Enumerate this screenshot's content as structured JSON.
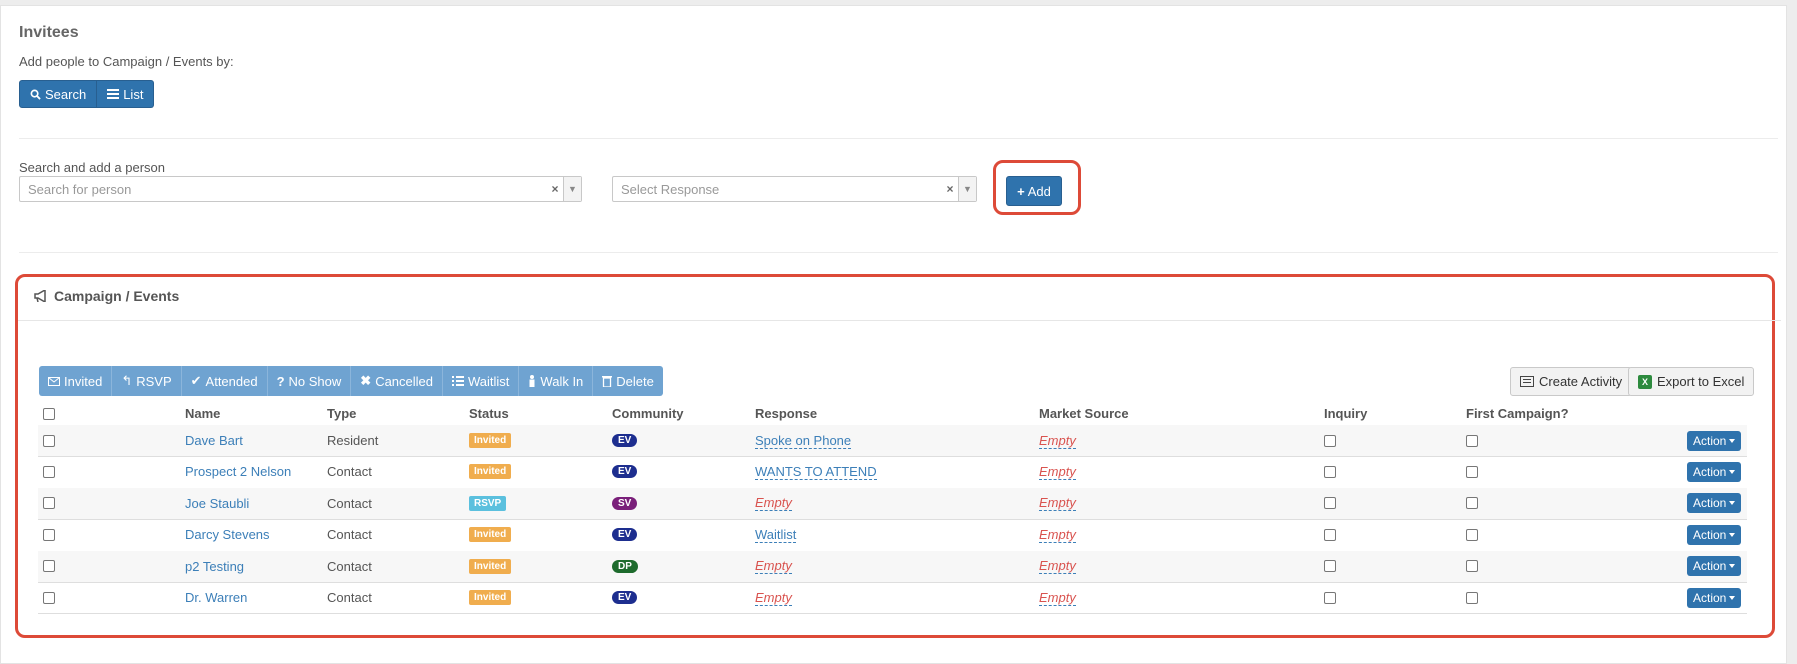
{
  "invitees": {
    "title": "Invitees",
    "subtitle": "Add people to Campaign / Events by:",
    "mode_buttons": [
      {
        "label": "Search",
        "icon": "search-icon"
      },
      {
        "label": "List",
        "icon": "list-icon"
      }
    ]
  },
  "search": {
    "label": "Search and add a person",
    "person_placeholder": "Search for person",
    "response_placeholder": "Select Response",
    "add_label": "Add"
  },
  "campaign": {
    "title": "Campaign / Events",
    "title_icon": "bullhorn-icon",
    "toolbar": [
      {
        "label": "Invited",
        "icon": "envelope-icon"
      },
      {
        "label": "RSVP",
        "icon": "reply-icon"
      },
      {
        "label": "Attended",
        "icon": "check-icon"
      },
      {
        "label": "No Show",
        "icon": "question-icon"
      },
      {
        "label": "Cancelled",
        "icon": "close-icon"
      },
      {
        "label": "Waitlist",
        "icon": "list-ol-icon"
      },
      {
        "label": "Walk In",
        "icon": "person-icon"
      },
      {
        "label": "Delete",
        "icon": "trash-icon"
      }
    ],
    "create_activity": "Create Activity",
    "export_excel": "Export to Excel",
    "columns": [
      "Name",
      "Type",
      "Status",
      "Community",
      "Response",
      "Market Source",
      "Inquiry",
      "First Campaign?"
    ],
    "action_label": "Action",
    "empty_text": "Empty",
    "rows": [
      {
        "name": "Dave Bart",
        "type": "Resident",
        "status": "Invited",
        "community": "EV",
        "response": "Spoke on Phone",
        "market_source": "Empty"
      },
      {
        "name": "Prospect 2 Nelson",
        "type": "Contact",
        "status": "Invited",
        "community": "EV",
        "response": "WANTS TO ATTEND",
        "market_source": "Empty"
      },
      {
        "name": "Joe Staubli",
        "type": "Contact",
        "status": "RSVP",
        "community": "SV",
        "response": "Empty",
        "market_source": "Empty"
      },
      {
        "name": "Darcy Stevens",
        "type": "Contact",
        "status": "Invited",
        "community": "EV",
        "response": "Waitlist",
        "market_source": "Empty"
      },
      {
        "name": "p2 Testing",
        "type": "Contact",
        "status": "Invited",
        "community": "DP",
        "response": "Empty",
        "market_source": "Empty"
      },
      {
        "name": "Dr. Warren",
        "type": "Contact",
        "status": "Invited",
        "community": "EV",
        "response": "Empty",
        "market_source": "Empty"
      }
    ]
  },
  "colors": {
    "primary": "#2f73ad",
    "toolbar": "#6fa3d1",
    "highlight": "#dd4a38",
    "status_invited": "#f0ad4e",
    "status_rsvp": "#5bc0de",
    "community_EV": "#1d2e8f",
    "community_SV": "#7a1f7a",
    "community_DP": "#1e6b2d",
    "empty_text": "#d9534f"
  }
}
